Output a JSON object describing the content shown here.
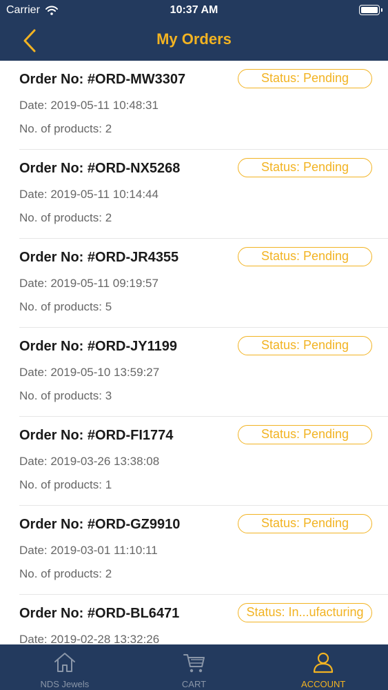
{
  "status_bar": {
    "carrier": "Carrier",
    "time": "10:37 AM"
  },
  "header": {
    "title": "My Orders"
  },
  "orders": [
    {
      "number": "Order No: #ORD-MW3307",
      "date": "Date: 2019-05-11 10:48:31",
      "products": "No. of products: 2",
      "status": "Status: Pending"
    },
    {
      "number": "Order No: #ORD-NX5268",
      "date": "Date: 2019-05-11 10:14:44",
      "products": "No. of products: 2",
      "status": "Status: Pending"
    },
    {
      "number": "Order No: #ORD-JR4355",
      "date": "Date: 2019-05-11 09:19:57",
      "products": "No. of products: 5",
      "status": "Status: Pending"
    },
    {
      "number": "Order No: #ORD-JY1199",
      "date": "Date: 2019-05-10 13:59:27",
      "products": "No. of products: 3",
      "status": "Status: Pending"
    },
    {
      "number": "Order No: #ORD-FI1774",
      "date": "Date: 2019-03-26 13:38:08",
      "products": "No. of products: 1",
      "status": "Status: Pending"
    },
    {
      "number": "Order No: #ORD-GZ9910",
      "date": "Date: 2019-03-01 11:10:11",
      "products": "No. of products: 2",
      "status": "Status: Pending"
    },
    {
      "number": "Order No: #ORD-BL6471",
      "date": "Date: 2019-02-28 13:32:26",
      "products": "",
      "status": "Status: In...ufacturing"
    }
  ],
  "tabbar": {
    "tabs": [
      {
        "label": "NDS Jewels",
        "icon": "home-icon"
      },
      {
        "label": "CART",
        "icon": "cart-icon"
      },
      {
        "label": "ACCOUNT",
        "icon": "account-icon",
        "active": true
      }
    ]
  },
  "colors": {
    "nav_bg": "#233a5e",
    "accent": "#f2b322",
    "inactive": "#8a96a8"
  }
}
